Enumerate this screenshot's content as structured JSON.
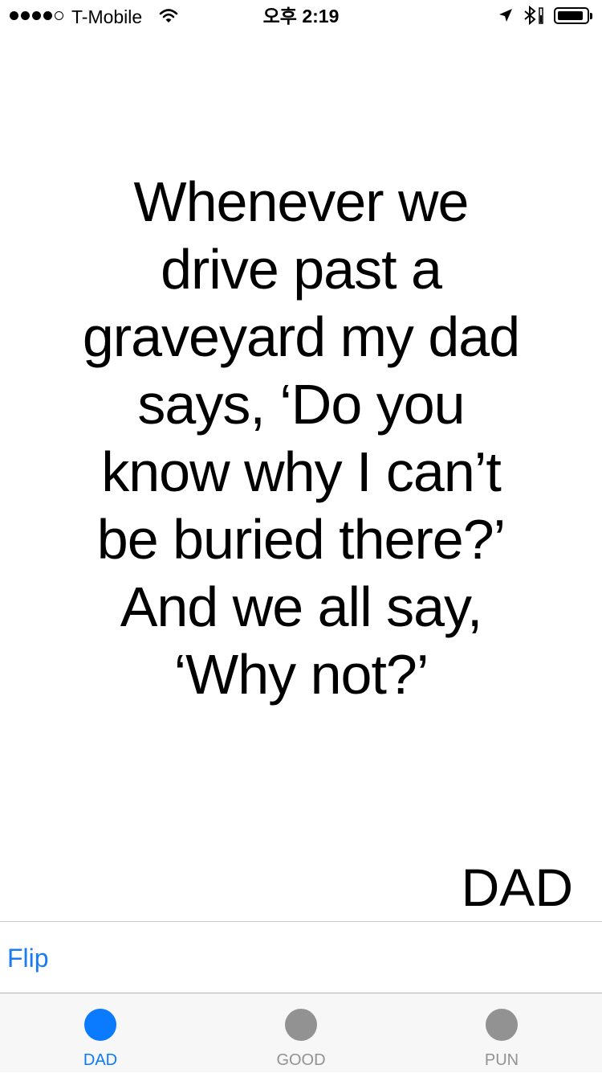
{
  "status_bar": {
    "carrier": "T-Mobile",
    "time": "오후 2:19",
    "signal_bars_filled": 4,
    "signal_bars_total": 5,
    "battery_level": 0.9
  },
  "quote": {
    "text": "Whenever we drive past a graveyard my dad says, ‘Do you know why I can’t be buried there?’ And we all say, ‘Why not?’",
    "category": "DAD"
  },
  "toolbar": {
    "flip_label": "Flip"
  },
  "tab_bar": {
    "tabs": [
      {
        "label": "DAD",
        "active": true
      },
      {
        "label": "GOOD",
        "active": false
      },
      {
        "label": "PUN",
        "active": false
      }
    ]
  },
  "colors": {
    "accent": "#0a7aff",
    "link": "#1a7cf3",
    "inactive_tab": "#929292",
    "tab_bar_bg": "#f7f7f7"
  },
  "icons": {
    "status": [
      "signal-dots-icon",
      "wifi-icon",
      "location-arrow-icon",
      "bluetooth-icon",
      "battery-icon"
    ],
    "tabs": [
      "circle-icon",
      "circle-icon",
      "circle-icon"
    ]
  }
}
